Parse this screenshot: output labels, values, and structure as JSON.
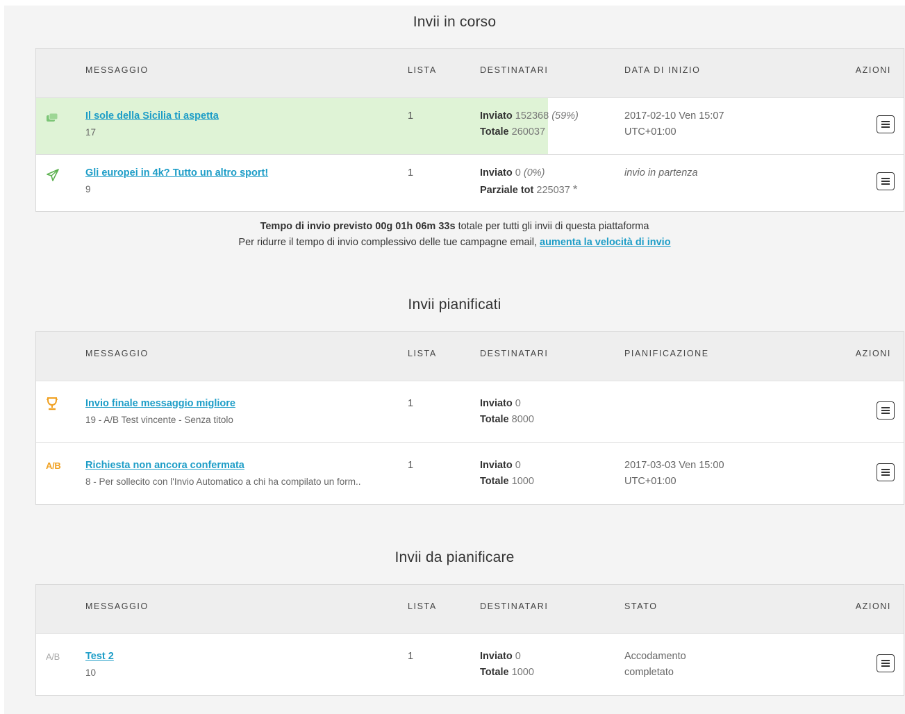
{
  "sections": {
    "in_progress": {
      "title": "Invii in corso",
      "headers": {
        "message": "MESSAGGIO",
        "list": "LISTA",
        "recipients": "DESTINATARI",
        "date": "DATA DI INIZIO",
        "actions": "AZIONI"
      },
      "rows": [
        {
          "icon": "stack-icon",
          "progress_percent": 59,
          "title": "Il sole della Sicilia ti aspetta",
          "subtitle": "17",
          "list": "1",
          "sent_label": "Inviato",
          "sent_value": "152368",
          "sent_pct": "(59%)",
          "total_label": "Totale",
          "total_value": "260037",
          "date_line1": "2017-02-10 Ven 15:07",
          "date_line2": "UTC+01:00"
        },
        {
          "icon": "paper-plane-icon",
          "title": "Gli europei in 4k? Tutto un altro sport!",
          "subtitle": "9",
          "list": "1",
          "sent_label": "Inviato",
          "sent_value": "0",
          "sent_pct": "(0%)",
          "total_label": "Parziale tot",
          "total_value": "225037",
          "total_mark": "*",
          "status": "invio in partenza"
        }
      ],
      "note": {
        "line1_bold": "Tempo di invio previsto 00g 01h 06m 33s",
        "line1_rest": "totale per tutti gli invii di questa piattaforma",
        "line2_text": "Per ridurre il tempo di invio complessivo delle tue campagne email,",
        "line2_link": "aumenta la velocità di invio"
      }
    },
    "scheduled": {
      "title": "Invii pianificati",
      "headers": {
        "message": "MESSAGGIO",
        "list": "LISTA",
        "recipients": "DESTINATARI",
        "date": "PIANIFICAZIONE",
        "actions": "AZIONI"
      },
      "rows": [
        {
          "icon": "trophy-icon",
          "title": "Invio finale messaggio migliore",
          "subtitle": "19 - A/B Test vincente - Senza titolo",
          "list": "1",
          "sent_label": "Inviato",
          "sent_value": "0",
          "total_label": "Totale",
          "total_value": "8000"
        },
        {
          "icon": "ab-test-icon",
          "icon_text": "A/B",
          "title": "Richiesta non ancora confermata",
          "subtitle": "8 - Per sollecito con l'Invio Automatico a chi ha compilato un form..",
          "list": "1",
          "sent_label": "Inviato",
          "sent_value": "0",
          "total_label": "Totale",
          "total_value": "1000",
          "date_line1": "2017-03-03 Ven 15:00",
          "date_line2": "UTC+01:00"
        }
      ]
    },
    "to_schedule": {
      "title": "Invii da pianificare",
      "headers": {
        "message": "MESSAGGIO",
        "list": "LISTA",
        "recipients": "DESTINATARI",
        "date": "STATO",
        "actions": "AZIONI"
      },
      "rows": [
        {
          "icon": "ab-test-icon",
          "icon_text": "A/B",
          "title": "Test 2",
          "subtitle": "10",
          "list": "1",
          "sent_label": "Inviato",
          "sent_value": "0",
          "total_label": "Totale",
          "total_value": "1000",
          "status_line1": "Accodamento",
          "status_line2": "completato"
        }
      ]
    }
  },
  "colors": {
    "link": "#1d9dc7",
    "progress": "#dff3d6",
    "stack_icon": "#7cc576",
    "plane_icon": "#5ab04d",
    "trophy_icon": "#f0a020",
    "ab_orange": "#f0a020",
    "ab_gray": "#aaaaaa"
  }
}
